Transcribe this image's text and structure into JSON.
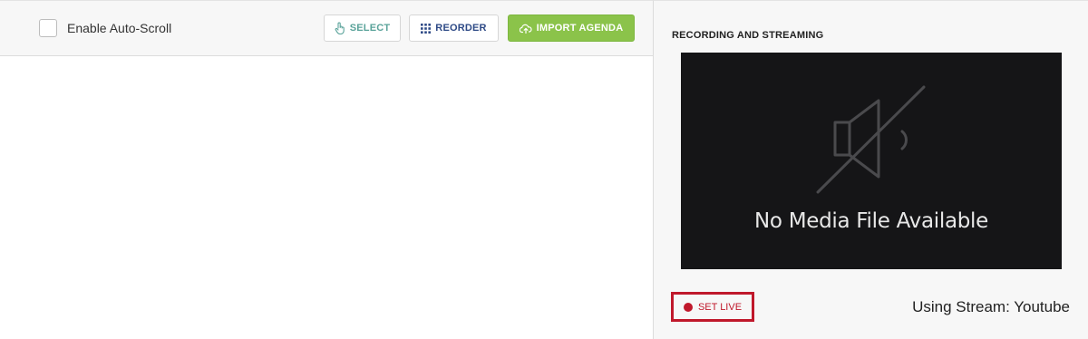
{
  "toolbar": {
    "autoscroll_label": "Enable Auto-Scroll",
    "autoscroll_checked": false,
    "select_label": "SELECT",
    "reorder_label": "REORDER",
    "import_label": "IMPORT AGENDA"
  },
  "recording": {
    "section_title": "RECORDING AND STREAMING",
    "player_message": "No Media File Available",
    "set_live_label": "SET LIVE",
    "stream_info": "Using Stream: Youtube"
  },
  "colors": {
    "import_button": "#8bc34a",
    "set_live_accent": "#c0182b",
    "player_bg": "#151517",
    "select_text": "#5aa39a",
    "reorder_text": "#2e4a86"
  },
  "icons": {
    "select": "hand-pointer-icon",
    "reorder": "grid-dots-icon",
    "import": "cloud-upload-icon",
    "player": "speaker-muted-icon",
    "live": "record-dot-icon"
  }
}
